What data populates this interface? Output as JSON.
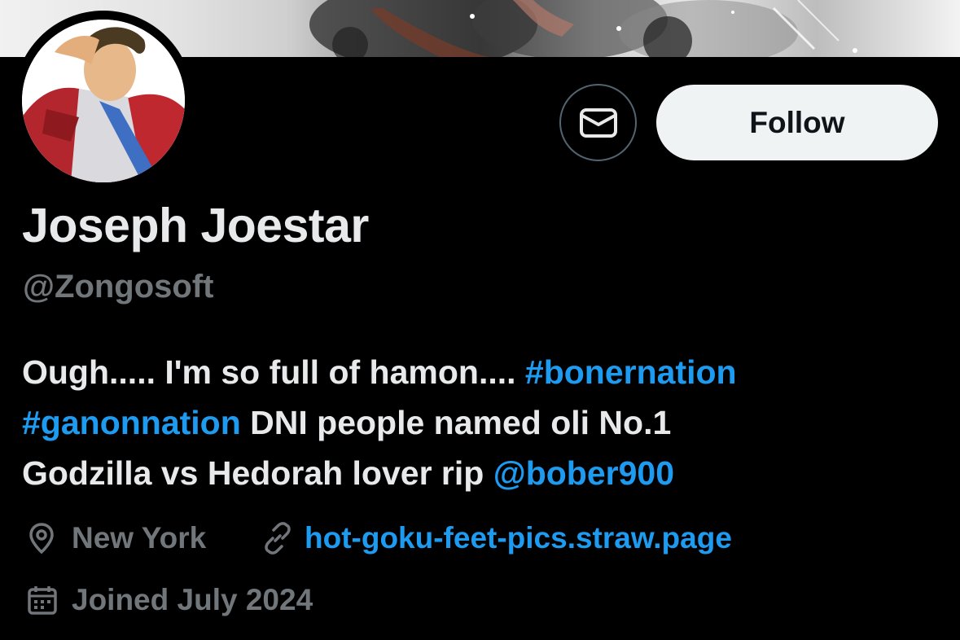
{
  "profile": {
    "display_name": "Joseph Joestar",
    "handle": "@Zongosoft",
    "bio": {
      "line1_text": "Ough..... I'm so full of hamon.... ",
      "line1_tag": "#bonernation",
      "line2_tag": "#ganonnation",
      "line2_text": " DNI people named oli No.1",
      "line3_text": "Godzilla vs Hedorah lover rip ",
      "line3_mention": "@bober900"
    },
    "location": "New York",
    "website": "hot-goku-feet-pics.straw.page",
    "joined": "Joined July 2024"
  },
  "actions": {
    "message_icon": "envelope-icon",
    "follow_label": "Follow"
  },
  "colors": {
    "background": "#000000",
    "text_primary": "#e7e9ea",
    "text_secondary": "#71767b",
    "accent": "#1d9bf0",
    "follow_button_bg": "#eff3f4"
  }
}
